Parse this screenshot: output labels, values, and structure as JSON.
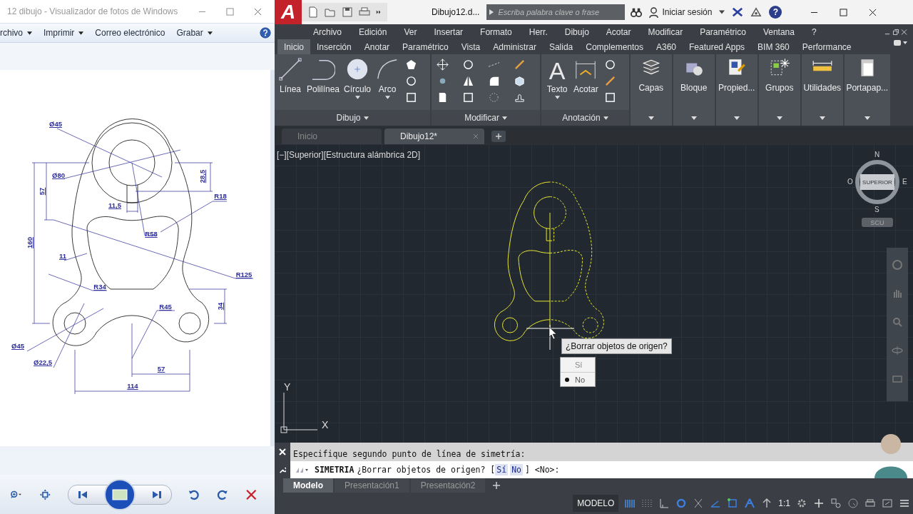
{
  "photo_viewer": {
    "title": "12 dibujo - Visualizador de fotos de Windows",
    "menu": [
      {
        "label": "rchivo",
        "dropdown": true
      },
      {
        "label": "Imprimir",
        "dropdown": true
      },
      {
        "label": "Correo electrónico",
        "dropdown": false
      },
      {
        "label": "Grabar",
        "dropdown": true
      }
    ],
    "dimension_labels": [
      "Ø45",
      "Ø80",
      "57",
      "160",
      "28,5",
      "11,5",
      "R18",
      "R58",
      "11",
      "R125",
      "R34",
      "R45",
      "34",
      "Ø45",
      "Ø22,5",
      "57",
      "114"
    ]
  },
  "autocad": {
    "logo": "A",
    "document_title": "Dibujo12.d...",
    "search": {
      "placeholder": "Escriba palabra clave o frase"
    },
    "sign_in": "Iniciar sesión",
    "help": "?",
    "menu": [
      "Archivo",
      "Edición",
      "Ver",
      "Insertar",
      "Formato",
      "Herr.",
      "Dibujo",
      "Acotar",
      "Modificar",
      "Paramétrico",
      "Ventana",
      "?"
    ],
    "ribbon_tabs": [
      {
        "label": "Inicio",
        "selected": true
      },
      {
        "label": "Inserción",
        "selected": false
      },
      {
        "label": "Anotar",
        "selected": false
      },
      {
        "label": "Paramétrico",
        "selected": false
      },
      {
        "label": "Vista",
        "selected": false
      },
      {
        "label": "Administrar",
        "selected": false
      },
      {
        "label": "Salida",
        "selected": false
      },
      {
        "label": "Complementos",
        "selected": false
      },
      {
        "label": "A360",
        "selected": false
      },
      {
        "label": "Featured Apps",
        "selected": false
      },
      {
        "label": "BIM 360",
        "selected": false
      },
      {
        "label": "Performance",
        "selected": false
      }
    ],
    "ribbon_panels": [
      {
        "label": "Dibujo",
        "kind": "tools",
        "tools": [
          {
            "label": "Línea",
            "dropdown": false
          },
          {
            "label": "Polilínea",
            "dropdown": false
          },
          {
            "label": "Círculo",
            "dropdown": true
          },
          {
            "label": "Arco",
            "dropdown": true
          }
        ]
      },
      {
        "label": "Modificar",
        "kind": "tools"
      },
      {
        "label": "Anotación",
        "kind": "tools",
        "tools": [
          {
            "label": "Texto",
            "dropdown": true,
            "glyph": "A"
          },
          {
            "label": "Acotar",
            "dropdown": false
          }
        ]
      },
      {
        "label": "Capas",
        "kind": "collapsed"
      },
      {
        "label": "Bloque",
        "kind": "collapsed"
      },
      {
        "label": "Propied...",
        "kind": "collapsed"
      },
      {
        "label": "Grupos",
        "kind": "collapsed"
      },
      {
        "label": "Utilidades",
        "kind": "collapsed"
      },
      {
        "label": "Portapap...",
        "kind": "collapsed"
      }
    ],
    "file_tabs": [
      {
        "label": "Inicio",
        "selected": false,
        "closable": false
      },
      {
        "label": "Dibujo12*",
        "selected": true,
        "closable": true
      }
    ],
    "viewport_label": "[−][Superior][Estructura alámbrica 2D]",
    "viewcube": {
      "north": "N",
      "south": "S",
      "east": "E",
      "west": "O",
      "face": "SUPERIOR",
      "ucs": "SCU"
    },
    "ucs_axes": {
      "y": "Y",
      "x": "X"
    },
    "tooltip": "¿Borrar objetos de origen?",
    "options": [
      {
        "label": "Sí",
        "selected": false
      },
      {
        "label": "No",
        "selected": true
      }
    ],
    "command_history": "Especifique segundo punto de línea de simetría:",
    "command_line": {
      "command": "SIMETRIA",
      "prompt": "¿Borrar objetos de origen? [",
      "options": [
        "Sí",
        "No"
      ],
      "suffix": "] <No>:"
    },
    "layout_tabs": [
      {
        "label": "Modelo",
        "selected": true
      },
      {
        "label": "Presentación1",
        "selected": false
      },
      {
        "label": "Presentación2",
        "selected": false
      }
    ],
    "status_bar": {
      "mode": "MODELO",
      "scale": "1:1"
    }
  }
}
